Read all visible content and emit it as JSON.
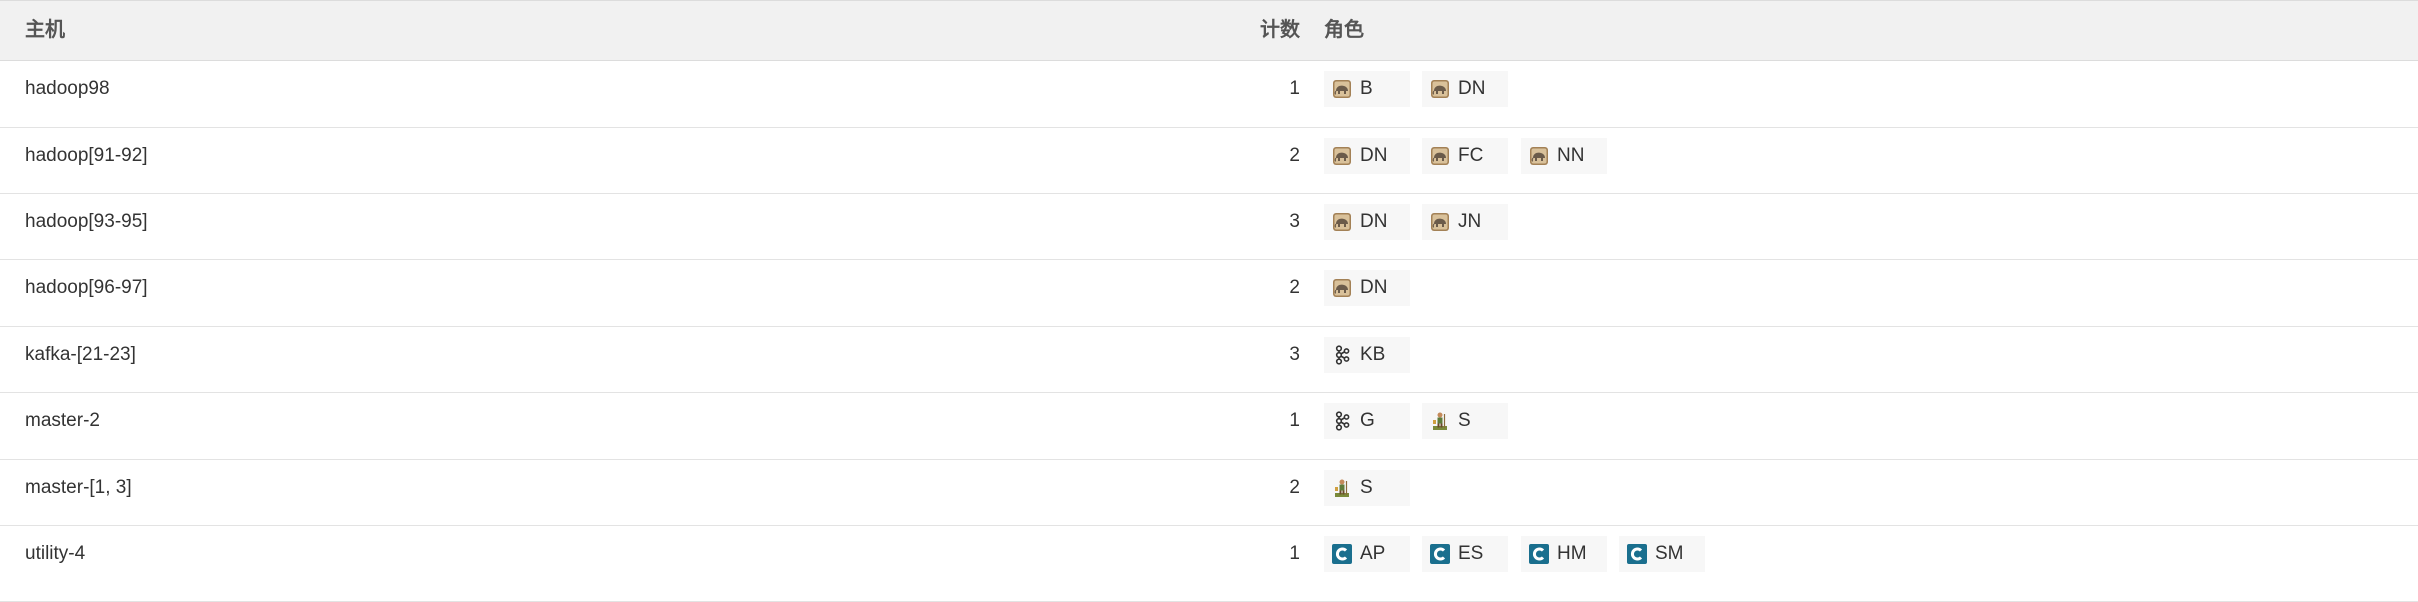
{
  "header": {
    "host": "主机",
    "count": "计数",
    "roles": "角色"
  },
  "rows": [
    {
      "host": "hadoop98",
      "count": "1",
      "roles": [
        {
          "icon": "hadoop-elephant-icon",
          "label": "B"
        },
        {
          "icon": "hadoop-elephant-icon",
          "label": "DN"
        }
      ]
    },
    {
      "host": "hadoop[91-92]",
      "count": "2",
      "roles": [
        {
          "icon": "hadoop-elephant-icon",
          "label": "DN"
        },
        {
          "icon": "hadoop-elephant-icon",
          "label": "FC"
        },
        {
          "icon": "hadoop-elephant-icon",
          "label": "NN"
        }
      ]
    },
    {
      "host": "hadoop[93-95]",
      "count": "3",
      "roles": [
        {
          "icon": "hadoop-elephant-icon",
          "label": "DN"
        },
        {
          "icon": "hadoop-elephant-icon",
          "label": "JN"
        }
      ]
    },
    {
      "host": "hadoop[96-97]",
      "count": "2",
      "roles": [
        {
          "icon": "hadoop-elephant-icon",
          "label": "DN"
        }
      ]
    },
    {
      "host": "kafka-[21-23]",
      "count": "3",
      "roles": [
        {
          "icon": "kafka-icon",
          "label": "KB"
        }
      ]
    },
    {
      "host": "master-2",
      "count": "1",
      "roles": [
        {
          "icon": "kafka-icon",
          "label": "G"
        },
        {
          "icon": "zookeeper-icon",
          "label": "S"
        }
      ]
    },
    {
      "host": "master-[1, 3]",
      "count": "2",
      "roles": [
        {
          "icon": "zookeeper-icon",
          "label": "S"
        }
      ]
    },
    {
      "host": "utility-4",
      "count": "1",
      "roles": [
        {
          "icon": "cloudera-icon",
          "label": "AP"
        },
        {
          "icon": "cloudera-icon",
          "label": "ES"
        },
        {
          "icon": "cloudera-icon",
          "label": "HM"
        },
        {
          "icon": "cloudera-icon",
          "label": "SM"
        }
      ]
    }
  ],
  "colors": {
    "header_bg": "#f1f1f1",
    "chip_bg": "#f7f7f7",
    "cloudera_blue": "#1a6f8e",
    "hadoop_tan": "#b8926a"
  }
}
